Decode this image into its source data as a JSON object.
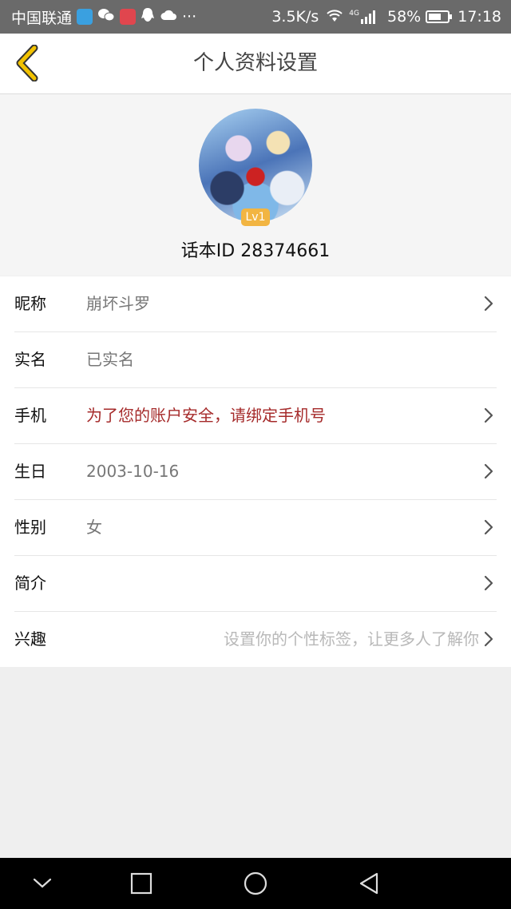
{
  "status_bar": {
    "carrier": "中国联通",
    "network_speed": "3.5K/s",
    "network_type": "4G",
    "battery_percent": "58%",
    "time": "17:18",
    "overflow": "···",
    "app_icons": [
      "video-app-icon",
      "wechat-icon",
      "app-icon",
      "qq-icon",
      "cloud-icon"
    ]
  },
  "header": {
    "title": "个人资料设置"
  },
  "profile": {
    "level": "Lv1",
    "id_label": "话本ID",
    "id_value": "28374661"
  },
  "fields": [
    {
      "label": "昵称",
      "value": "崩坏斗罗",
      "has_arrow": true
    },
    {
      "label": "实名",
      "value": "已实名",
      "has_arrow": false
    },
    {
      "label": "手机",
      "value": "为了您的账户安全，请绑定手机号",
      "has_arrow": true,
      "warning": true
    },
    {
      "label": "生日",
      "value": "2003-10-16",
      "has_arrow": true
    },
    {
      "label": "性别",
      "value": "女",
      "has_arrow": true
    },
    {
      "label": "简介",
      "value": "",
      "has_arrow": true
    },
    {
      "label": "兴趣",
      "placeholder": "设置你的个性标签，让更多人了解你",
      "has_arrow": true
    }
  ],
  "colors": {
    "accent_back": "#f2c200",
    "warning_text": "#a52a2a",
    "level_badge": "#f2b542"
  }
}
